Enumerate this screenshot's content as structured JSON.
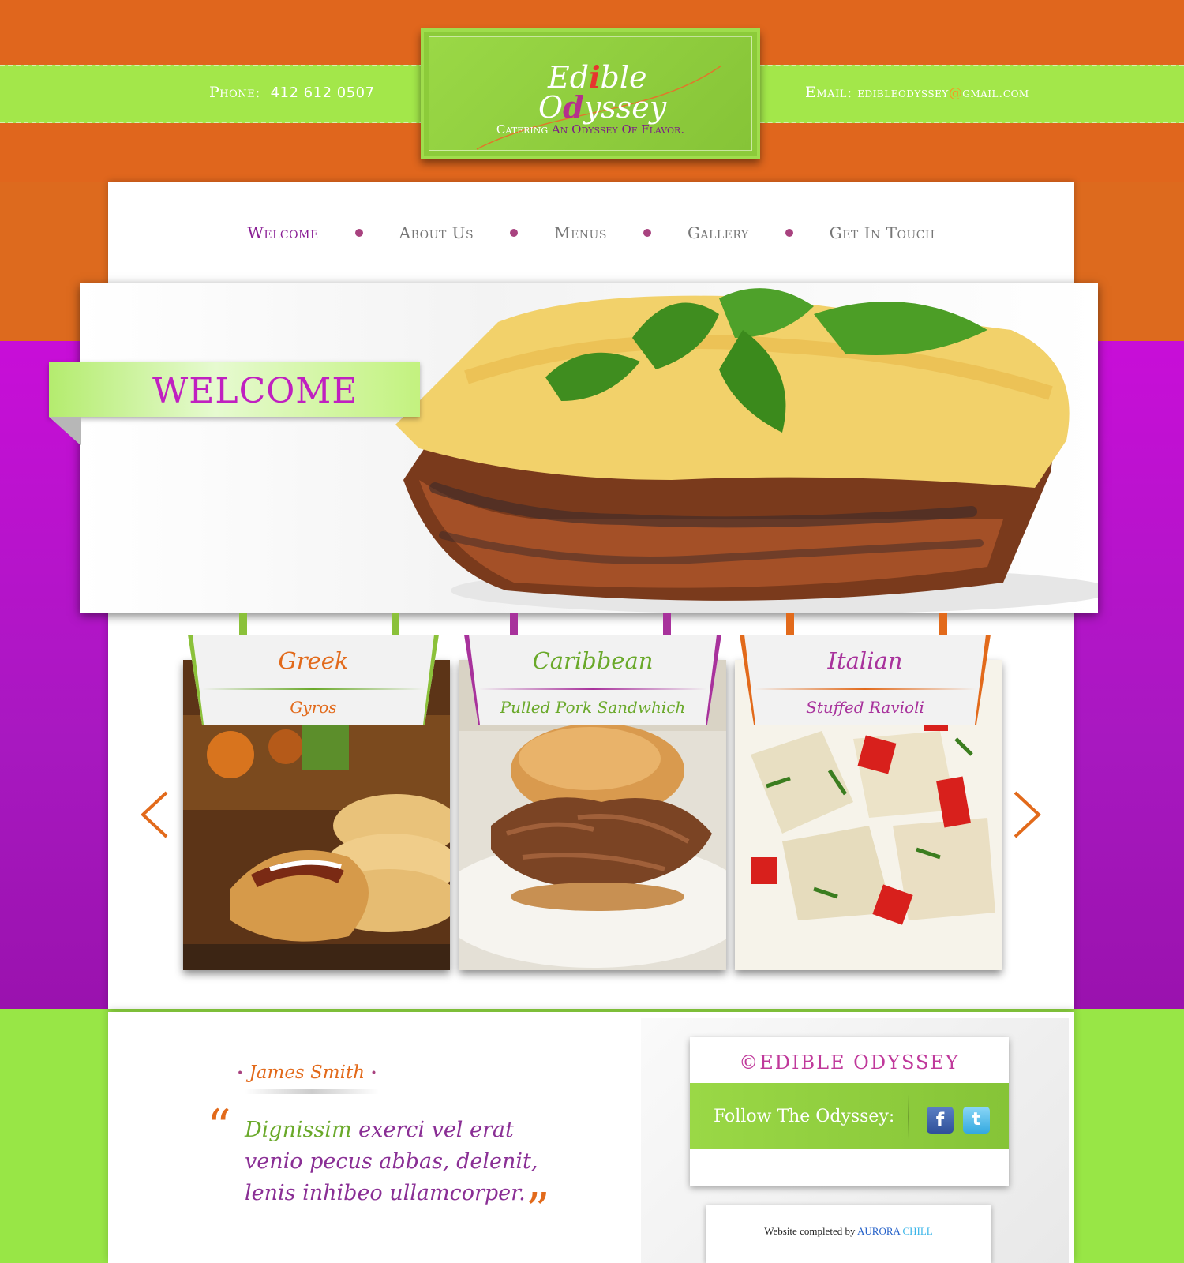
{
  "header": {
    "phone_label": "Phone:",
    "phone_number": "412  612  0507",
    "email_label": "Email:",
    "email_user": "edibleodyssey",
    "email_at": "@",
    "email_domain": "gmail.com"
  },
  "logo": {
    "title_line1_a": "Ed",
    "title_line1_i": "i",
    "title_line1_b": "ble",
    "title_line2_a": "O",
    "title_line2_d": "d",
    "title_line2_b": "yssey",
    "tagline_a": "Catering",
    "tagline_b": "An Odyssey Of Flavor."
  },
  "nav": {
    "items": [
      {
        "label": "Welcome"
      },
      {
        "label": "About Us"
      },
      {
        "label": "Menus"
      },
      {
        "label": "Gallery"
      },
      {
        "label": "Get In Touch"
      }
    ]
  },
  "hero": {
    "banner": "WELCOME"
  },
  "cards": [
    {
      "category": "Greek",
      "dish": "Gyros",
      "category_color": "#e26a1b",
      "dish_color": "#e26a1b"
    },
    {
      "category": "Caribbean",
      "dish": "Pulled Pork Sandwhich",
      "category_color": "#6aa92a",
      "dish_color": "#6aa92a"
    },
    {
      "category": "Italian",
      "dish": "Stuffed Ravioli",
      "category_color": "#a8329c",
      "dish_color": "#a8329c"
    }
  ],
  "carousel": {
    "prev_icon": "chevron-left-icon",
    "next_icon": "chevron-right-icon"
  },
  "testimonial": {
    "author": "James Smith",
    "quote_line1_a": "Dignissim",
    "quote_line1_b": "exerci vel erat",
    "quote_line2": "venio pecus abbas, delenit,",
    "quote_line3": "lenis inhibeo ullamcorper."
  },
  "footer": {
    "brand": "©EDIBLE ODYSSEY",
    "follow": "Follow The Odyssey:",
    "facebook": "f",
    "twitter": "t",
    "credit_prefix": "Website completed by",
    "credit_a": "AURORA",
    "credit_b": "CHILL"
  },
  "colors": {
    "orange": "#e0661d",
    "lime": "#a3e74a",
    "magenta": "#c80ed8",
    "purple": "#8a1f95"
  }
}
